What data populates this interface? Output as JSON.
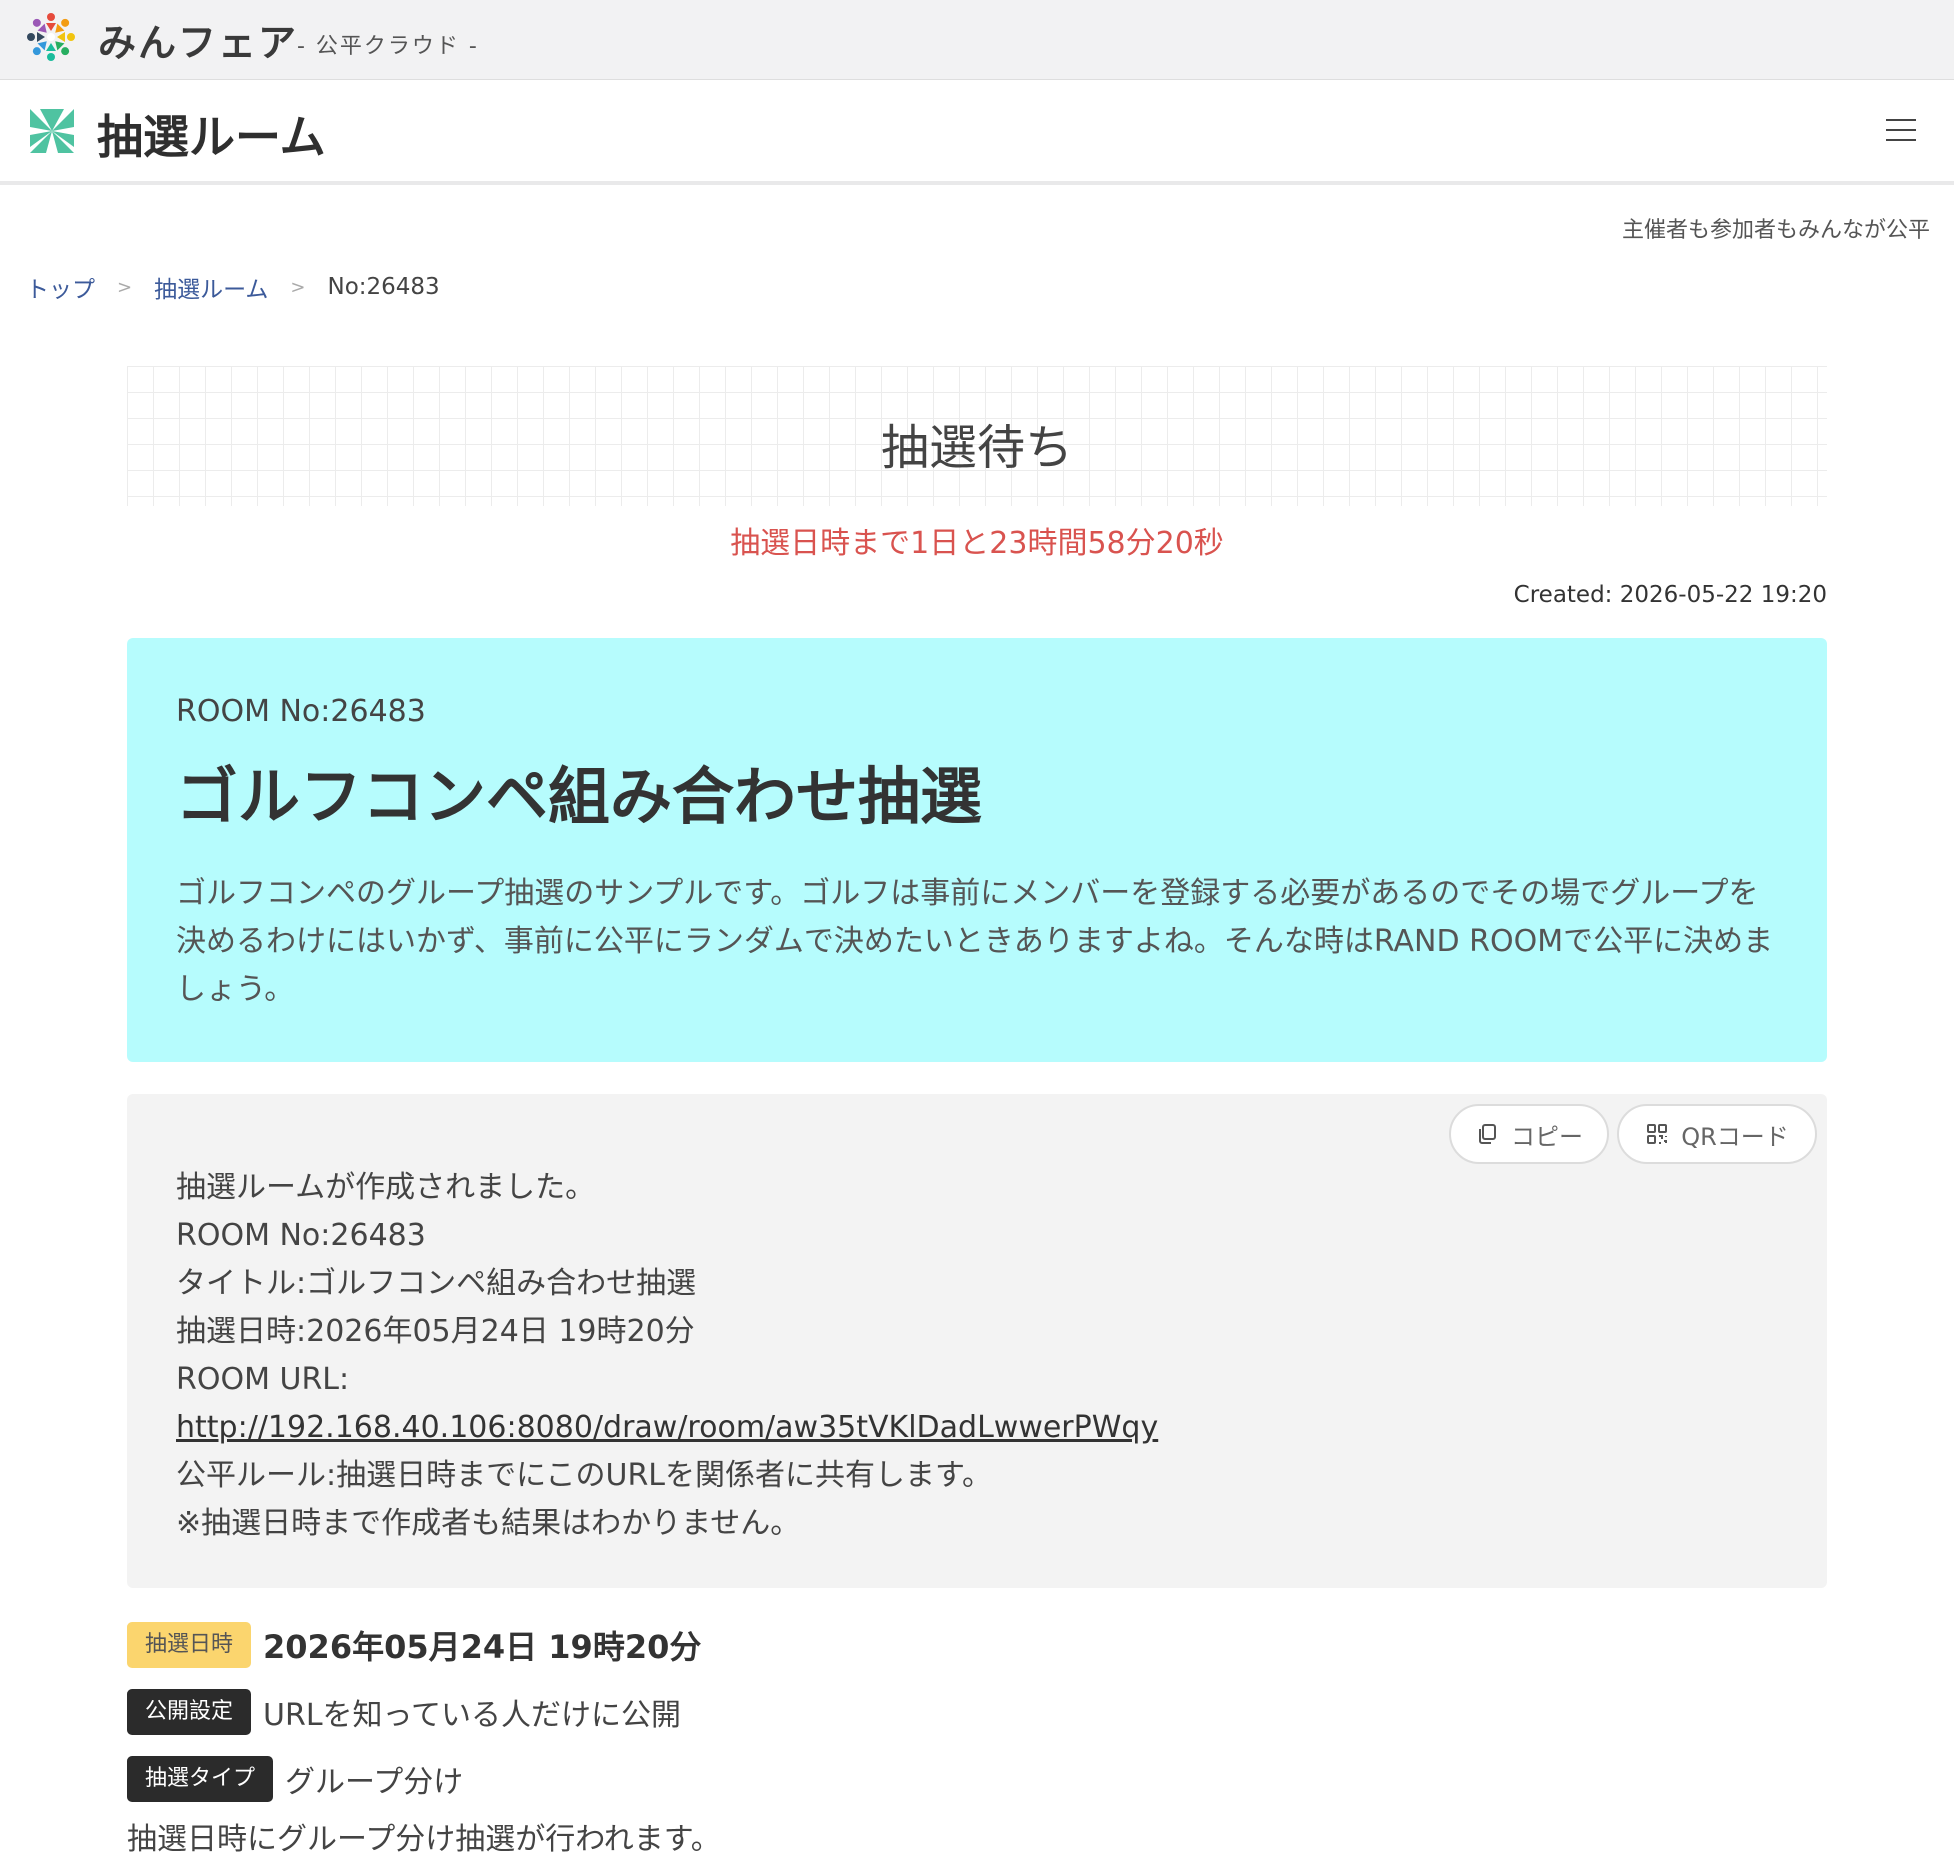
{
  "brand": {
    "name": "みんフェア",
    "subtitle": "- 公平クラウド -"
  },
  "app": {
    "title": "抽選ルーム",
    "menu_icon": "hamburger-icon"
  },
  "tagline": "主催者も参加者もみんなが公平",
  "breadcrumb": {
    "home": "トップ",
    "section": "抽選ルーム",
    "current": "No:26483",
    "separator": ">"
  },
  "status": {
    "label": "抽選待ち",
    "countdown": "抽選日時まで1日と23時間58分20秒",
    "created": "Created: 2026-05-22 19:20"
  },
  "room": {
    "number": "ROOM No:26483",
    "title": "ゴルフコンペ組み合わせ抽選",
    "description": "ゴルフコンペのグループ抽選のサンプルです。ゴルフは事前にメンバーを登録する必要があるのでその場でグループを決めるわけにはいかず、事前に公平にランダムで決めたいときありますよね。そんな時はRAND ROOMで公平に決めましょう。"
  },
  "share": {
    "copy_label": "コピー",
    "qr_label": "QRコード",
    "lines": {
      "created": "抽選ルームが作成されました。",
      "room_no": "ROOM No:26483",
      "title": "タイトル:ゴルフコンペ組み合わせ抽選",
      "draw_datetime": "抽選日時:2026年05月24日 19時20分",
      "url_label": "ROOM URL:",
      "url": "http://192.168.40.106:8080/draw/room/aw35tVKlDadLwwerPWqy",
      "rule": "公平ルール:抽選日時までにこのURLを関係者に共有します。",
      "note": "※抽選日時まで作成者も結果はわかりません。"
    }
  },
  "meta": {
    "draw_date": {
      "badge": "抽選日時",
      "value": "2026年05月24日 19時20分"
    },
    "visibility": {
      "badge": "公開設定",
      "value": "URLを知っている人だけに公開"
    },
    "draw_type": {
      "badge": "抽選タイプ",
      "value": "グループ分け"
    },
    "note": "抽選日時にグループ分け抽選が行われます。"
  },
  "colors": {
    "room_card_bg": "#b6fcfd",
    "countdown": "#d9534f",
    "badge_yellow": "#fbd56e",
    "badge_dark": "#2b2b2b",
    "link": "#3c5a9a"
  }
}
